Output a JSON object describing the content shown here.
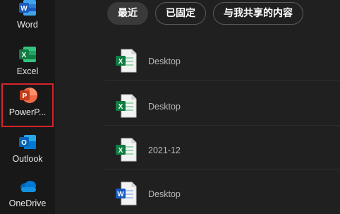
{
  "sidebar": {
    "apps": [
      {
        "label": "Word",
        "icon": "word-icon",
        "color": "#2b579a"
      },
      {
        "label": "Excel",
        "icon": "excel-icon",
        "color": "#217346"
      },
      {
        "label": "PowerP...",
        "icon": "powerpoint-icon",
        "color": "#c43e1c",
        "selected": true
      },
      {
        "label": "Outlook",
        "icon": "outlook-icon",
        "color": "#0078d4"
      },
      {
        "label": "OneDrive",
        "icon": "onedrive-icon",
        "color": "#0a6fd8"
      }
    ]
  },
  "tabs": [
    {
      "label": "最近",
      "active": true
    },
    {
      "label": "已固定",
      "active": false
    },
    {
      "label": "与我共享的内容",
      "active": false
    }
  ],
  "files": [
    {
      "type": "excel",
      "icon": "excel-file-icon",
      "location": "Desktop"
    },
    {
      "type": "excel",
      "icon": "excel-file-icon",
      "location": "Desktop"
    },
    {
      "type": "excel",
      "icon": "excel-file-icon",
      "location": "2021-12"
    },
    {
      "type": "word",
      "icon": "word-file-icon",
      "location": "Desktop"
    }
  ],
  "colors": {
    "selected_outline": "#d6242c",
    "background": "#202020"
  }
}
